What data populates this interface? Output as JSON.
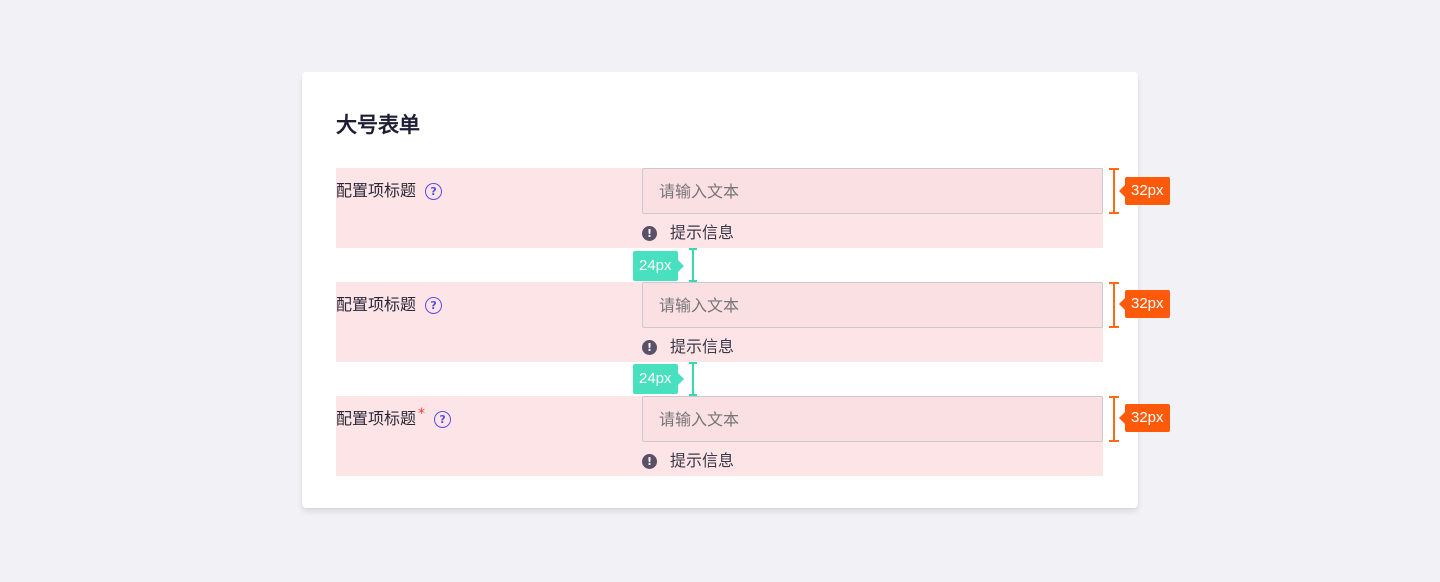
{
  "form": {
    "title": "大号表单",
    "rows": [
      {
        "label": "配置项标题",
        "required": false,
        "placeholder": "请输入文本",
        "hint": "提示信息",
        "height_annotation": "32px"
      },
      {
        "label": "配置项标题",
        "required": false,
        "placeholder": "请输入文本",
        "hint": "提示信息",
        "height_annotation": "32px"
      },
      {
        "label": "配置项标题",
        "required": true,
        "required_mark": "*",
        "placeholder": "请输入文本",
        "hint": "提示信息",
        "height_annotation": "32px"
      }
    ],
    "help_icon_glyph": "?",
    "hint_icon_glyph": "!",
    "spacing_annotations": [
      "24px",
      "24px"
    ]
  },
  "icons": {
    "help": "question-circle-icon",
    "hint": "exclamation-circle-icon"
  },
  "colors": {
    "background": "#f2f1f6",
    "card": "#ffffff",
    "row_highlight": "#fde4e6",
    "help_icon": "#5b4de6",
    "required": "#f03e3e",
    "height_annotation": "#ff5a0a",
    "spacing_annotation": "#48e0be"
  }
}
